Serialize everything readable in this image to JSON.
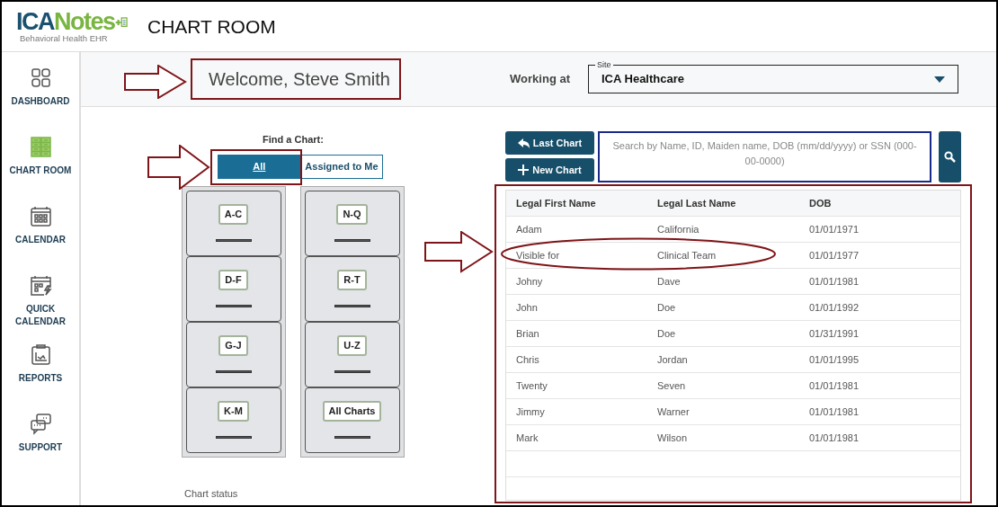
{
  "logo": {
    "text": "ICANotes",
    "tagline": "Behavioral Health EHR"
  },
  "page_title": "CHART ROOM",
  "sidebar": {
    "items": [
      {
        "label": "DASHBOARD",
        "kind": "dashboard",
        "selected": false
      },
      {
        "label": "CHART ROOM",
        "kind": "chartroom",
        "selected": true
      },
      {
        "label": "CALENDAR",
        "kind": "calendar",
        "selected": false
      },
      {
        "label": "QUICK CALENDAR",
        "kind": "quickcalendar",
        "selected": false
      },
      {
        "label": "REPORTS",
        "kind": "reports",
        "selected": false
      },
      {
        "label": "SUPPORT",
        "kind": "support",
        "selected": false
      }
    ]
  },
  "welcome": "Welcome, Steve Smith",
  "working_at": {
    "label": "Working at",
    "site_label": "Site",
    "value": "ICA Healthcare"
  },
  "find_chart": {
    "title": "Find a Chart:",
    "filters": [
      {
        "label": "All",
        "selected": true
      },
      {
        "label": "Assigned to Me",
        "selected": false
      }
    ]
  },
  "cabinets": [
    {
      "drawers": [
        {
          "label": "A-C"
        },
        {
          "label": "D-F"
        },
        {
          "label": "G-J"
        },
        {
          "label": "K-M"
        }
      ]
    },
    {
      "drawers": [
        {
          "label": "N-Q"
        },
        {
          "label": "R-T"
        },
        {
          "label": "U-Z"
        },
        {
          "label": "All Charts"
        }
      ]
    }
  ],
  "chart_status": "Chart status",
  "buttons": [
    {
      "label": "Last Chart",
      "kind": "last"
    },
    {
      "label": "New Chart",
      "kind": "new"
    }
  ],
  "search": {
    "placeholder": "Search by Name, ID, Maiden name, DOB (mm/dd/yyyy) or SSN (000-00-0000)"
  },
  "table": {
    "columns": [
      "Legal First Name",
      "Legal Last Name",
      "DOB"
    ],
    "rows": [
      [
        "Adam",
        "California",
        "01/01/1971"
      ],
      [
        "Visible for",
        "Clinical Team",
        "01/01/1977"
      ],
      [
        "Johny",
        "Dave",
        "01/01/1981"
      ],
      [
        "John",
        "Doe",
        "01/01/1992"
      ],
      [
        "Brian",
        "Doe",
        "01/31/1991"
      ],
      [
        "Chris",
        "Jordan",
        "01/01/1995"
      ],
      [
        "Twenty",
        "Seven",
        "01/01/1981"
      ],
      [
        "Jimmy",
        "Warner",
        "01/01/1981"
      ],
      [
        "Mark",
        "Wilson",
        "01/01/1981"
      ]
    ]
  }
}
